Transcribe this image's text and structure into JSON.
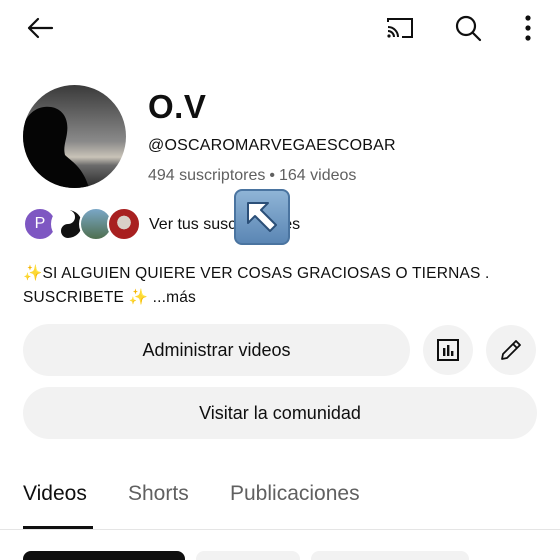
{
  "channel": {
    "name": "O.V",
    "handle": "@OSCAROMARVEGAESCOBAR",
    "subscribers": "494 suscriptores",
    "stats_separator": "•",
    "videos": "164 videos"
  },
  "subscriptions_row": {
    "first_avatar_letter": "P",
    "label": "Ver tus suscripciones"
  },
  "description": {
    "line1": "✨SI ALGUIEN QUIERE VER COSAS GRACIOSAS O TIERNAS .",
    "line2": "SUSCRIBETE ✨",
    "more": "...más"
  },
  "buttons": {
    "manage_videos": "Administrar videos",
    "visit_community": "Visitar la comunidad"
  },
  "tabs": [
    {
      "label": "Videos",
      "active": true
    },
    {
      "label": "Shorts",
      "active": false
    },
    {
      "label": "Publicaciones",
      "active": false
    }
  ],
  "colors": {
    "pill_bg": "#f2f2f2",
    "text_primary": "#0f0f0f",
    "text_secondary": "#606060",
    "avatar_p": "#7e57c2"
  },
  "icons": {
    "back": "arrow-left-icon",
    "cast": "cast-icon",
    "search": "search-icon",
    "more": "more-vert-icon",
    "analytics": "bar-chart-icon",
    "edit": "pencil-icon",
    "cursor": "arrow-up-left-icon"
  }
}
